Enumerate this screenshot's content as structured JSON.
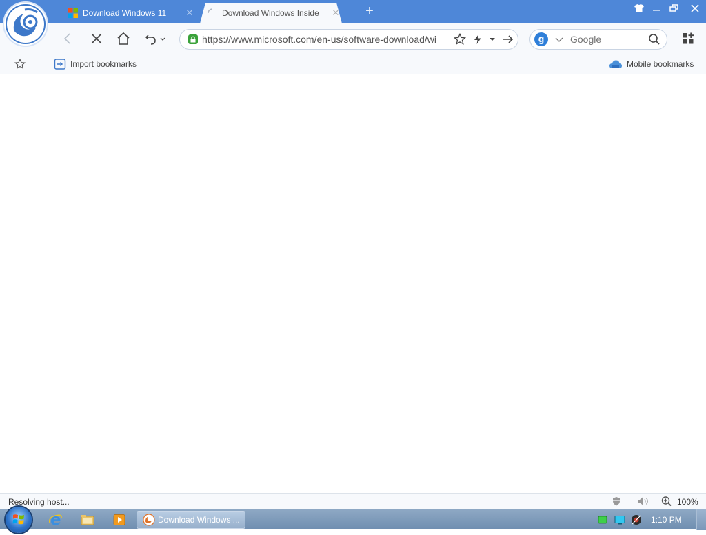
{
  "colors": {
    "titlebar": "#4e87d8",
    "toolbar": "#f7f9fc",
    "secure_green": "#3aa23a",
    "accent_blue": "#2f7fd9"
  },
  "tabs": [
    {
      "title": "Download Windows 11",
      "active": true,
      "icon": "windows-logo-icon"
    },
    {
      "title": "Download Windows Inside",
      "active": false,
      "icon": "loading-spinner-icon"
    }
  ],
  "address_bar": {
    "url": "https://www.microsoft.com/en-us/software-download/wi"
  },
  "search": {
    "engine_letter": "g",
    "placeholder": "Google"
  },
  "bookmarks": {
    "import_label": "Import bookmarks",
    "mobile_label": "Mobile bookmarks"
  },
  "status": {
    "text": "Resolving host...",
    "zoom": "100%"
  },
  "taskbar": {
    "app_label": "Download Windows ...",
    "time": "1:10 PM"
  }
}
